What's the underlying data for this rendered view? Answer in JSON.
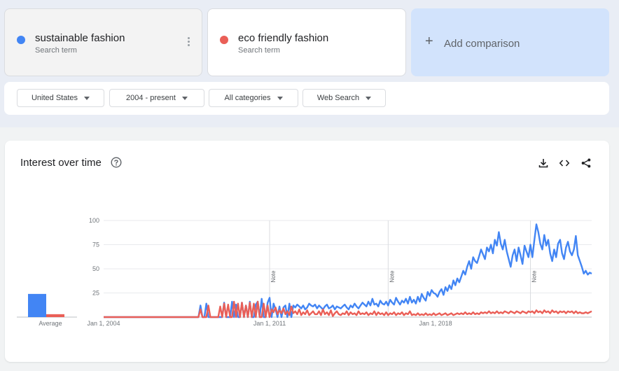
{
  "terms": [
    {
      "name": "sustainable fashion",
      "subtitle": "Search term",
      "color": "#4285f4"
    },
    {
      "name": "eco friendly fashion",
      "subtitle": "Search term",
      "color": "#ea5f57"
    }
  ],
  "add_comparison": {
    "plus": "+",
    "label": "Add comparison"
  },
  "filters": {
    "region": "United States",
    "time_range": "2004 - present",
    "category": "All categories",
    "search_type": "Web Search"
  },
  "panel": {
    "title": "Interest over time"
  },
  "chart_data": {
    "type": "line",
    "title": "Interest over time",
    "x_start": "Jan 1, 2004",
    "x_ticks": [
      "Jan 1, 2004",
      "Jan 1, 2011",
      "Jan 1, 2018"
    ],
    "y_ticks": [
      "100",
      "75",
      "50",
      "25"
    ],
    "ylim": [
      0,
      100
    ],
    "xlim": [
      "2004-01",
      "2024-08"
    ],
    "grid": true,
    "note_label": "Note",
    "notes": [
      "2011-01",
      "2016-01",
      "2022-01"
    ],
    "average_label": "Average",
    "averages": [
      {
        "name": "sustainable fashion",
        "value": 24,
        "color": "#4285f4"
      },
      {
        "name": "eco friendly fashion",
        "value": 3,
        "color": "#ea5f57"
      }
    ],
    "series": [
      {
        "name": "sustainable fashion",
        "color": "#4285f4",
        "yearly": [
          [
            2004,
            [
              0,
              0,
              0,
              0,
              0,
              0,
              0,
              0,
              0,
              0,
              0,
              0
            ]
          ],
          [
            2005,
            [
              0,
              0,
              0,
              0,
              0,
              0,
              0,
              0,
              0,
              0,
              0,
              0
            ]
          ],
          [
            2006,
            [
              0,
              0,
              0,
              0,
              0,
              0,
              0,
              0,
              0,
              0,
              0,
              0
            ]
          ],
          [
            2007,
            [
              0,
              0,
              0,
              0,
              0,
              0,
              0,
              0,
              0,
              0,
              0,
              0
            ]
          ],
          [
            2008,
            [
              0,
              12,
              0,
              0,
              14,
              0,
              0,
              0,
              0,
              0,
              0,
              0
            ]
          ],
          [
            2009,
            [
              0,
              15,
              0,
              0,
              0,
              16,
              0,
              13,
              0,
              0,
              15,
              0
            ]
          ],
          [
            2010,
            [
              12,
              0,
              16,
              0,
              0,
              13,
              16,
              0,
              19,
              0,
              0,
              15
            ]
          ],
          [
            2011,
            [
              20,
              0,
              14,
              8,
              0,
              11,
              0,
              10,
              12,
              0,
              14,
              0
            ]
          ],
          [
            2012,
            [
              12,
              10,
              13,
              11,
              9,
              12,
              8,
              10,
              14,
              12,
              11,
              13
            ]
          ],
          [
            2013,
            [
              9,
              12,
              10,
              8,
              11,
              13,
              9,
              10,
              12,
              8,
              11,
              10
            ]
          ],
          [
            2014,
            [
              9,
              11,
              13,
              10,
              8,
              12,
              10,
              14,
              11,
              9,
              12,
              15
            ]
          ],
          [
            2015,
            [
              13,
              11,
              16,
              12,
              19,
              13,
              14,
              11,
              17,
              14,
              13,
              16
            ]
          ],
          [
            2016,
            [
              12,
              18,
              15,
              13,
              20,
              16,
              13,
              17,
              15,
              19,
              14,
              21
            ]
          ],
          [
            2017,
            [
              15,
              18,
              14,
              21,
              16,
              24,
              20,
              17,
              26,
              22,
              28,
              25
            ]
          ],
          [
            2018,
            [
              24,
              21,
              26,
              29,
              23,
              31,
              27,
              33,
              29,
              38,
              33,
              40
            ]
          ],
          [
            2019,
            [
              36,
              42,
              48,
              44,
              52,
              58,
              50,
              62,
              58,
              56,
              63,
              70
            ]
          ],
          [
            2020,
            [
              65,
              60,
              72,
              68,
              75,
              66,
              80,
              74,
              88,
              76,
              70,
              80
            ]
          ],
          [
            2021,
            [
              68,
              60,
              52,
              64,
              70,
              58,
              72,
              64,
              55,
              74,
              68,
              62
            ]
          ],
          [
            2022,
            [
              75,
              62,
              80,
              96,
              88,
              76,
              70,
              85,
              74,
              80,
              66,
              58
            ]
          ],
          [
            2023,
            [
              70,
              62,
              76,
              80,
              66,
              60,
              72,
              78,
              68,
              64,
              70,
              84
            ]
          ],
          [
            2024,
            [
              64,
              58,
              52,
              45,
              48,
              44,
              46,
              45
            ]
          ]
        ]
      },
      {
        "name": "eco friendly fashion",
        "color": "#ea5f57",
        "yearly": [
          [
            2004,
            [
              0,
              0,
              0,
              0,
              0,
              0,
              0,
              0,
              0,
              0,
              0,
              0
            ]
          ],
          [
            2005,
            [
              0,
              0,
              0,
              0,
              0,
              0,
              0,
              0,
              0,
              0,
              0,
              0
            ]
          ],
          [
            2006,
            [
              0,
              0,
              0,
              0,
              0,
              0,
              0,
              0,
              0,
              0,
              0,
              0
            ]
          ],
          [
            2007,
            [
              0,
              0,
              0,
              0,
              0,
              0,
              0,
              0,
              0,
              0,
              0,
              0
            ]
          ],
          [
            2008,
            [
              0,
              8,
              0,
              0,
              0,
              12,
              0,
              0,
              0,
              0,
              0,
              11
            ]
          ],
          [
            2009,
            [
              0,
              14,
              0,
              13,
              0,
              0,
              16,
              0,
              14,
              0,
              15,
              0
            ]
          ],
          [
            2010,
            [
              12,
              0,
              15,
              0,
              14,
              0,
              16,
              0,
              0,
              14,
              0,
              12
            ]
          ],
          [
            2011,
            [
              0,
              8,
              5,
              10,
              3,
              7,
              4,
              9,
              3,
              6,
              2,
              11
            ]
          ],
          [
            2012,
            [
              4,
              6,
              3,
              8,
              2,
              5,
              3,
              7,
              2,
              4,
              6,
              3
            ]
          ],
          [
            2013,
            [
              3,
              6,
              2,
              8,
              3,
              5,
              2,
              7,
              1,
              4,
              6,
              3
            ]
          ],
          [
            2014,
            [
              2,
              4,
              3,
              6,
              2,
              5,
              3,
              4,
              2,
              6,
              3,
              4
            ]
          ],
          [
            2015,
            [
              3,
              5,
              2,
              4,
              3,
              6,
              2,
              5,
              3,
              4,
              2,
              5
            ]
          ],
          [
            2016,
            [
              2,
              4,
              3,
              5,
              2,
              4,
              3,
              5,
              2,
              4,
              3,
              6
            ]
          ],
          [
            2017,
            [
              2,
              3,
              2,
              4,
              2,
              3,
              2,
              4,
              2,
              3,
              2,
              4
            ]
          ],
          [
            2018,
            [
              2,
              3,
              4,
              2,
              3,
              4,
              2,
              3,
              4,
              2,
              3,
              4
            ]
          ],
          [
            2019,
            [
              3,
              4,
              3,
              5,
              3,
              4,
              3,
              5,
              3,
              4,
              3,
              5
            ]
          ],
          [
            2020,
            [
              4,
              5,
              4,
              6,
              4,
              5,
              4,
              6,
              4,
              5,
              4,
              6
            ]
          ],
          [
            2021,
            [
              5,
              4,
              6,
              5,
              4,
              6,
              5,
              4,
              6,
              5,
              4,
              6
            ]
          ],
          [
            2022,
            [
              5,
              6,
              4,
              7,
              5,
              6,
              4,
              7,
              5,
              6,
              4,
              7
            ]
          ],
          [
            2023,
            [
              5,
              6,
              4,
              6,
              5,
              6,
              4,
              6,
              5,
              6,
              4,
              6
            ]
          ],
          [
            2024,
            [
              4,
              5,
              4,
              4,
              5,
              4,
              5,
              6
            ]
          ]
        ]
      }
    ]
  }
}
